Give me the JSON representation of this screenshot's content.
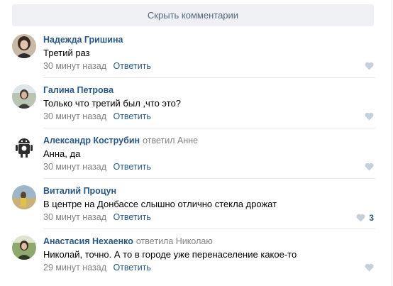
{
  "hide_comments_label": "Скрыть комментарии",
  "colors": {
    "link": "#2a5885",
    "meta": "#828282",
    "button_bg": "#eef0f3",
    "heart": "#c5d0db"
  },
  "comments": [
    {
      "author": "Надежда Гришина",
      "replied": "",
      "text": "Третий раз",
      "time": "30 минут назад",
      "reply_label": "Ответить",
      "likes": ""
    },
    {
      "author": "Галина Петрова",
      "replied": "",
      "text": "Только что третий был ,что это?",
      "time": "30 минут назад",
      "reply_label": "Ответить",
      "likes": ""
    },
    {
      "author": "Александр Кострубин",
      "replied": "ответил Анне",
      "text": "Анна, да",
      "time": "30 минут назад",
      "reply_label": "Ответить",
      "likes": ""
    },
    {
      "author": "Виталий Процун",
      "replied": "",
      "text": "В центре на Донбассе слышно отлично стекла дрожат",
      "time": "30 минут назад",
      "reply_label": "Ответить",
      "likes": "3"
    },
    {
      "author": "Анастасия Нехаенко",
      "replied": "ответила Николаю",
      "text": "Николай, точно. А то в городе уже перенаселение какое-то",
      "time": "29 минут назад",
      "reply_label": "Ответить",
      "likes": ""
    }
  ]
}
